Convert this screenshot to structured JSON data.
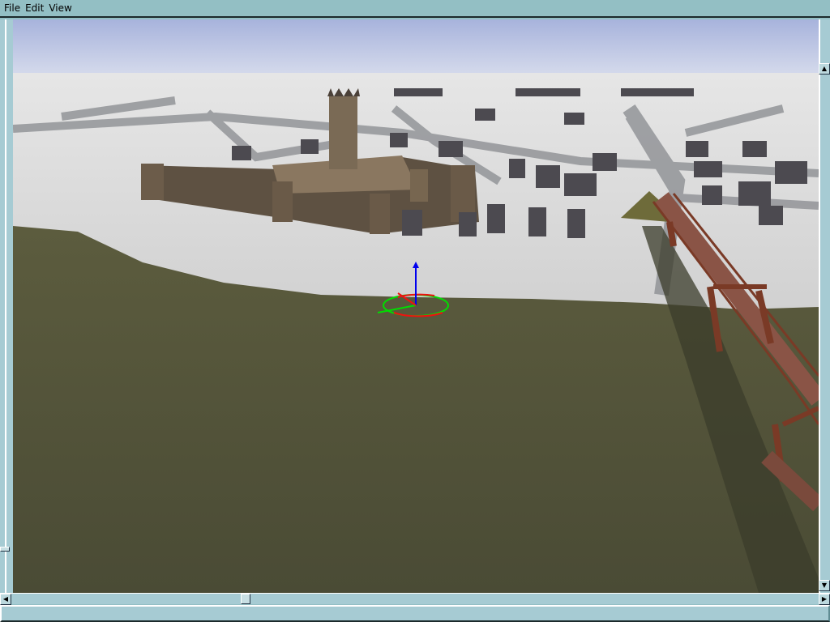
{
  "menu": {
    "file": "File",
    "edit": "Edit",
    "view": "View"
  },
  "scrollbars": {
    "horizontal_position": 0.29,
    "vertical_position": 0.0,
    "zoom_slider_position": 0.92
  },
  "status_text": "",
  "colors": {
    "chrome": "#93bfc4",
    "sky": "#aab6de",
    "snow": "#dcdcdc",
    "grass": "#55553a"
  }
}
